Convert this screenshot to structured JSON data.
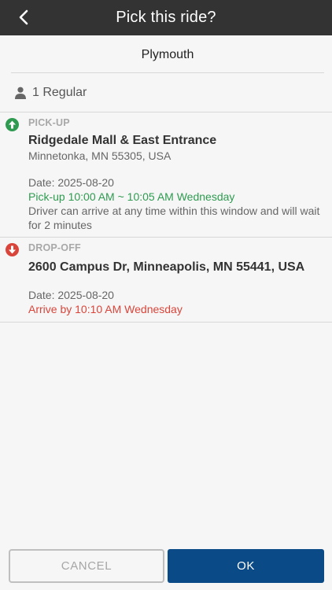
{
  "header": {
    "title": "Pick this ride?",
    "back_icon": "chevron-left-icon"
  },
  "region": {
    "name": "Plymouth"
  },
  "passenger": {
    "icon": "person-icon",
    "label": "1 Regular"
  },
  "pickup": {
    "icon": "arrow-up-circle-icon",
    "label": "PICK-UP",
    "title": "Ridgedale Mall & East Entrance",
    "subtitle": "Minnetonka, MN 55305, USA",
    "date": "Date: 2025-08-20",
    "window": "Pick-up 10:00 AM ~ 10:05 AM Wednesday",
    "note": "Driver can arrive at any time within this window and will wait for 2 minutes",
    "color": "#2e9b50"
  },
  "dropoff": {
    "icon": "arrow-down-circle-icon",
    "label": "DROP-OFF",
    "title": "2600 Campus Dr, Minneapolis, MN 55441, USA",
    "date": "Date: 2025-08-20",
    "arrive": "Arrive by 10:10 AM Wednesday",
    "color": "#d9453a"
  },
  "buttons": {
    "cancel": "CANCEL",
    "ok": "OK",
    "ok_color": "#0a4a86"
  }
}
